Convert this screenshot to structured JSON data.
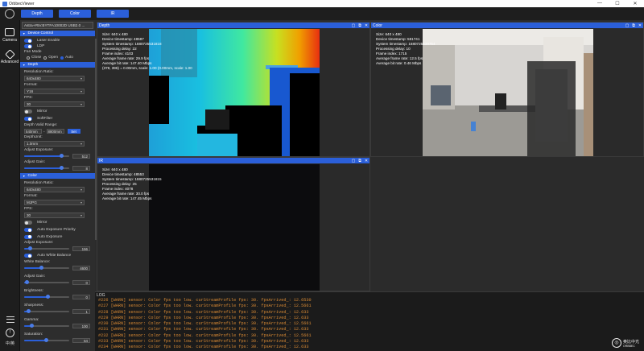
{
  "window": {
    "title": "OrbbecViewer",
    "min": "—",
    "max": "☐",
    "close": "✕"
  },
  "tabs": [
    "Depth",
    "Color",
    "IR"
  ],
  "nav": {
    "camera": "Camera",
    "advanced": "Advanced",
    "info_icon": "info-icon",
    "lang": "中/英"
  },
  "sidebar": {
    "device": "Astra+#5V.BYTFA10002D USB2.0 ...",
    "device_control": {
      "header": "Device Control",
      "laser": "Laser Enable",
      "ldp": "LDP",
      "fan_mode": "Fan Mode",
      "fan_options": [
        "Close",
        "Open",
        "Auto"
      ],
      "fan_selected": "Auto"
    },
    "depth": {
      "header": "Depth",
      "resolution_label": "Resolution Ratio:",
      "resolution": "640x480",
      "format_label": "Format:",
      "format": "Y16",
      "fps_label": "FPS:",
      "fps": "30",
      "mirror": "Mirror",
      "softfilter": "SoftFilter",
      "valid_range_label": "Depth Valid Range:",
      "range_min": "540mm",
      "range_sep": "-",
      "range_max": "8800mm",
      "set": "Set",
      "unit_label": "DepthUnit:",
      "unit": "1.0mm",
      "exposure_label": "Adjust Exposure:",
      "exposure": "512",
      "gain_label": "Adjust Gain:",
      "gain": "8"
    },
    "color": {
      "header": "Color",
      "resolution_label": "Resolution Ratio:",
      "resolution": "640x480",
      "format_label": "Format:",
      "format": "MJPG",
      "fps_label": "FPS:",
      "fps": "30",
      "mirror": "Mirror",
      "auto_exp_priority": "Auto Exposure Priority",
      "auto_exp": "Auto Exposure",
      "exposure_label": "Adjust Exposure:",
      "exposure": "156",
      "awb": "Auto White Balance",
      "wb_label": "White Balance:",
      "wb": "4600",
      "gain_label": "Adjust Gain:",
      "gain": "0",
      "brightness_label": "Brightness:",
      "brightness": "0",
      "sharpness_label": "Sharpness:",
      "sharpness": "1",
      "gamma_label": "Gamma:",
      "gamma": "100",
      "saturation_label": "Saturation:",
      "saturation": "64"
    }
  },
  "panels": {
    "depth": {
      "title": "Depth",
      "overlay": "Size: 640 x 480\nDevice timestamp: 48587\nSystem timestamp: 1680725531818\nProcessing delay: 22\nFrame index: 4103\nAverage frame rate: 29.9 fps\nAverage bit rate: 147.40 Mbps\n(378, 396) = 0.00mm, scale: 1.00 (0.00mm, scale: 1.00"
    },
    "color": {
      "title": "Color",
      "overlay": "Size: 640 x 480\nDevice timestamp: 581741\nSystem timestamp: 1680725539764\nProcessing delay: 10\nFrame index: 1715\nAverage frame rate: 12.5 fps\nAverage bit rate: 0.46 Mbps"
    },
    "ir": {
      "title": "IR",
      "overlay": "Size: 640 x 480\nDevice timestamp: 48553\nSystem timestamp: 1680725531815\nProcessing delay: 25\nFrame index: 4078\nAverage frame rate: 30.0 fps\nAverage bit rate: 147.45 Mbps"
    },
    "controls": [
      "▢",
      "⧉",
      "✕"
    ]
  },
  "log": {
    "title": "LOG",
    "lines": [
      "#226 [WARN] sensor: Color fps too low. curStreamProfile fps: 30. fpsArrived_: 12.6530",
      "#227 [WARN] sensor: Color fps too low. curStreamProfile fps: 30. fpsArrived_: 12.5661",
      "#228 [WARN] sensor: Color fps too low. curStreamProfile fps: 30. fpsArrived_: 12.633",
      "#229 [WARN] sensor: Color fps too low. curStreamProfile fps: 30. fpsArrived_: 12.633",
      "#230 [WARN] sensor: Color fps too low. curStreamProfile fps: 30. fpsArrived_: 12.5661",
      "#231 [WARN] sensor: Color fps too low. curStreamProfile fps: 30. fpsArrived_: 12.633",
      "#232 [WARN] sensor: Color fps too low. curStreamProfile fps: 30. fpsArrived_: 12.5661",
      "#233 [WARN] sensor: Color fps too low. curStreamProfile fps: 30. fpsArrived_: 12.633",
      "#234 [WARN] sensor: Color fps too low. curStreamProfile fps: 30. fpsArrived_: 12.633"
    ]
  },
  "watermark": {
    "text": "奥比中光",
    "sub": "ORBBEC"
  },
  "colors": {
    "accent": "#2b5fd9",
    "log": "#d98a34",
    "bg": "#2b2b2b"
  }
}
